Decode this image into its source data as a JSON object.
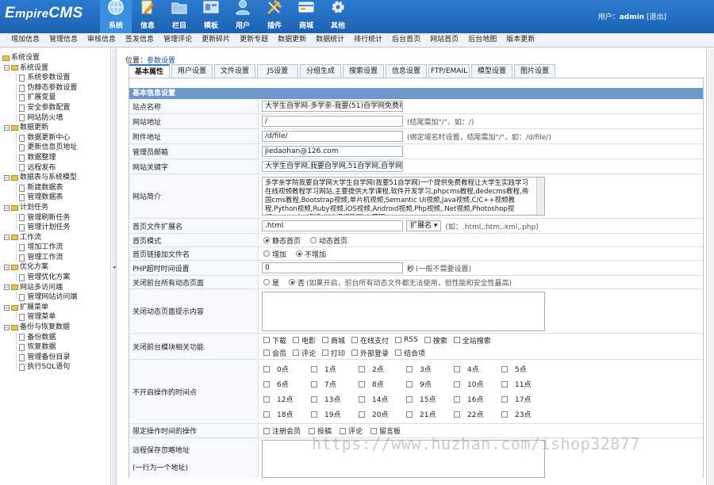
{
  "logo": {
    "text_big": "E",
    "text_rest": "mpire",
    "text_cms": "CMS"
  },
  "topnav": [
    {
      "label": "系统",
      "icon": "globe-icon",
      "active": true
    },
    {
      "label": "信息",
      "icon": "pencil-doc-icon"
    },
    {
      "label": "栏目",
      "icon": "folder-icon"
    },
    {
      "label": "模板",
      "icon": "template-icon"
    },
    {
      "label": "用户",
      "icon": "user-icon"
    },
    {
      "label": "插件",
      "icon": "plugin-icon"
    },
    {
      "label": "商城",
      "icon": "card-icon"
    },
    {
      "label": "其他",
      "icon": "gear-icon"
    }
  ],
  "user": {
    "prefix": "用户：",
    "name": "admin",
    "logout": "[退出]"
  },
  "menubar": [
    "增加信息",
    "管理信息",
    "审核信息",
    "签发信息",
    "管理评论",
    "更新碎片",
    "更新专题",
    "数据更新",
    "数据统计",
    "排行统计",
    "后台首页",
    "网站首页",
    "后台地图",
    "版本更新"
  ],
  "sidebar": {
    "root": "系统设置",
    "groups": [
      {
        "label": "系统设置",
        "items": [
          "系统参数设置",
          "伪静态参数设置",
          "扩展变量",
          "安全参数配置",
          "网站防火墙"
        ]
      },
      {
        "label": "数据更新",
        "items": [
          "数据更新中心",
          "更新信息页地址",
          "数据整理",
          "远程发布"
        ]
      },
      {
        "label": "数据表与系统模型",
        "items": [
          "新建数据表",
          "管理数据表"
        ]
      },
      {
        "label": "计划任务",
        "items": [
          "管理刷新任务",
          "管理计划任务"
        ]
      },
      {
        "label": "工作流",
        "items": [
          "增加工作流",
          "管理工作流"
        ]
      },
      {
        "label": "优化方案",
        "items": [
          "管理优化方案"
        ]
      },
      {
        "label": "网站多访问端",
        "items": [
          "管理网站访问端"
        ]
      },
      {
        "label": "扩展菜单",
        "items": [
          "管理菜单"
        ]
      },
      {
        "label": "备份与恢复数据",
        "items": [
          "备份数据",
          "恢复数据",
          "管理备份目录",
          "执行SQL语句"
        ]
      }
    ]
  },
  "breadcrumb": {
    "prefix": "位置：",
    "link": "参数设置"
  },
  "tabs": [
    "基本属性",
    "用户设置",
    "文件设置",
    "JS设置",
    "分组生成",
    "搜索设置",
    "信息设置",
    "FTP/EMAIL",
    "模型设置",
    "图片设置"
  ],
  "form": {
    "header": "基本信息设置",
    "site_name": {
      "label": "站点名称",
      "value": "大学生自学网-多学亲-我要(51)自学网免费视频"
    },
    "site_url": {
      "label": "网站地址",
      "value": "/",
      "hint": "(结尾需加\"/\"，如：/)"
    },
    "attach_url": {
      "label": "附件地址",
      "value": "/d/file/",
      "hint": "(绑定域名时设置，结尾需加\"/\"，如：/d/file/)"
    },
    "admin_email": {
      "label": "管理员邮箱",
      "value": "jiedaohan@126.com"
    },
    "keywords": {
      "label": "网站关键字",
      "value": "大学生自学网,我要自学网,51自学网,自学网,多"
    },
    "intro": {
      "label": "网站简介",
      "value": "多学亲学院我要自学网大学生自学网(我要51自学网)一个提供免费教程让大学生实践学习在线视频教程学习网站,主要提供大学课程,软件开发学习,phpcms教程,dedecms教程,帝国cms教程,Bootstrap视频,单片机视频,Semantic UI视频,Java视频,C/C++视频教程,Python视频,Ruby视频,iOS视频,Android视频,Php视频,.Net视频,Photoshop视频,Javascript视频,CSS视频教程,白苹网"
    },
    "ext": {
      "label": "首页文件扩展名",
      "value": ".html",
      "select": "扩展名 ▾",
      "hint": "(如：.html,.htm,.xml,.php)"
    },
    "home_mode": {
      "label": "首页模式",
      "options": [
        "静态首页",
        "动态首页"
      ],
      "selected": 0
    },
    "home_link_name": {
      "label": "首页链接加文件名",
      "options": [
        "增加",
        "不增加"
      ],
      "selected": 1
    },
    "php_timeout": {
      "label": "PHP超时时间设置",
      "value": "0",
      "unit": "秒",
      "hint": "(一般不需要设置)"
    },
    "close_dynamic": {
      "label": "关闭前台所有动态页面",
      "options": [
        "是",
        "否"
      ],
      "selected": 1,
      "hint": "(如果开启，前台所有动态文件都无法使用，但性能和安全性最高)"
    },
    "close_tip": {
      "label": "关闭动态页面提示内容",
      "value": ""
    },
    "close_modules": {
      "label": "关闭前台模块相关功能",
      "row1": [
        "下载",
        "电影",
        "商城",
        "在线支付",
        "RSS",
        "搜索",
        "全站搜索"
      ],
      "row2": [
        "会员",
        "评论",
        "打印",
        "外部登录",
        "结合项"
      ]
    },
    "closed_hours": {
      "label": "不开启操作的时间点",
      "hours": [
        "0点",
        "1点",
        "2点",
        "3点",
        "4点",
        "5点",
        "6点",
        "7点",
        "8点",
        "9点",
        "10点",
        "11点",
        "12点",
        "13点",
        "14点",
        "15点",
        "16点",
        "17点",
        "18点",
        "19点",
        "20点",
        "21点",
        "22点",
        "23点"
      ]
    },
    "limit_ops": {
      "label": "限定操作时间的操作",
      "options": [
        "注册会员",
        "投稿",
        "评论",
        "留言板"
      ]
    },
    "remote_ignore": {
      "label": "远程保存忽略地址",
      "sub": "(一行为一个地址)"
    }
  },
  "watermark": "https://www.huzhan.com/ishop32877"
}
